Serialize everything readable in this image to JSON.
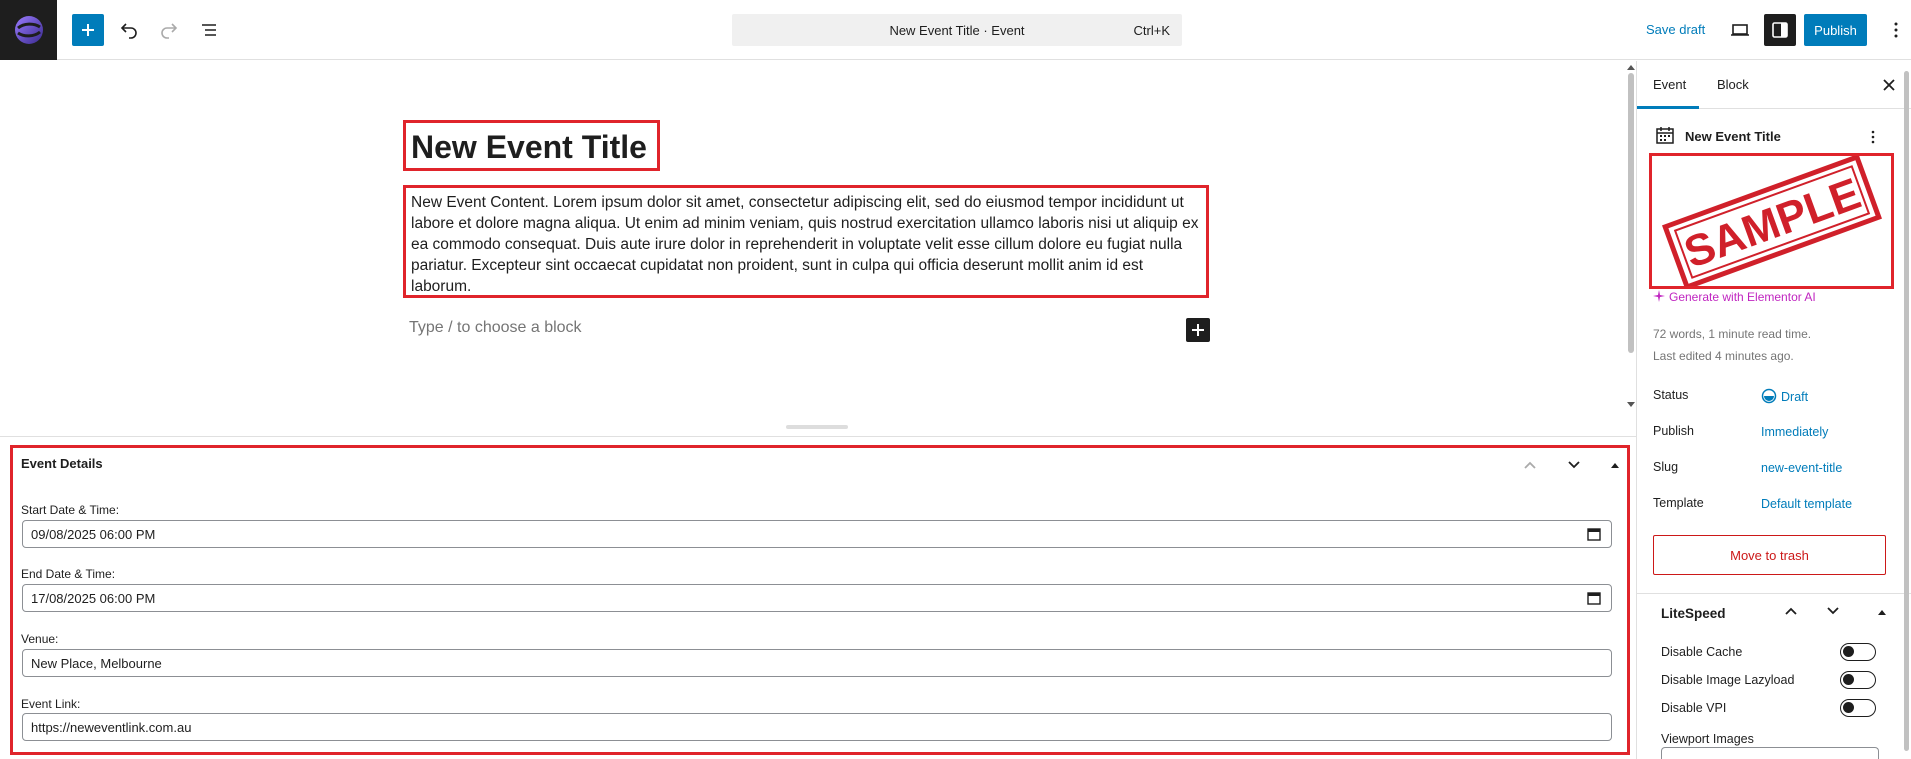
{
  "topbar": {
    "command_title": "New Event Title · Event",
    "command_shortcut": "Ctrl+K",
    "save_draft": "Save draft",
    "publish": "Publish"
  },
  "editor": {
    "title": "New Event Title",
    "content": "New Event Content. Lorem ipsum dolor sit amet, consectetur adipiscing elit, sed do eiusmod tempor incididunt ut labore et dolore magna aliqua. Ut enim ad minim veniam, quis nostrud exercitation ullamco laboris nisi ut aliquip ex ea commodo consequat. Duis aute irure dolor in reprehenderit in voluptate velit esse cillum dolore eu fugiat nulla pariatur. Excepteur sint occaecat cupidatat non proident, sunt in culpa qui officia deserunt mollit anim id est laborum.",
    "placeholder": "Type / to choose a block"
  },
  "event_details": {
    "title": "Event Details",
    "start_label": "Start Date & Time:",
    "start_value": "09/08/2025 06:00 PM",
    "end_label": "End Date & Time:",
    "end_value": "17/08/2025 06:00 PM",
    "venue_label": "Venue:",
    "venue_value": "New Place, Melbourne",
    "link_label": "Event Link:",
    "link_value": "https://neweventlink.com.au"
  },
  "sidebar": {
    "tab_event": "Event",
    "tab_block": "Block",
    "doc_title": "New Event Title",
    "featured_stamp": "SAMPLE",
    "generate_ai": "Generate with Elementor AI",
    "word_count": "72 words, 1 minute read time.",
    "last_edited": "Last edited 4 minutes ago.",
    "status_label": "Status",
    "status_value": "Draft",
    "publish_label": "Publish",
    "publish_value": "Immediately",
    "slug_label": "Slug",
    "slug_value": "new-event-title",
    "template_label": "Template",
    "template_value": "Default template",
    "trash": "Move to trash",
    "litespeed": {
      "title": "LiteSpeed",
      "disable_cache": "Disable Cache",
      "disable_lazyload": "Disable Image Lazyload",
      "disable_vpi": "Disable VPI",
      "viewport_images": "Viewport Images"
    }
  },
  "colors": {
    "accent": "#007cba",
    "highlight_border": "#e0242b",
    "danger": "#cc1818",
    "ai": "#c025c0"
  }
}
